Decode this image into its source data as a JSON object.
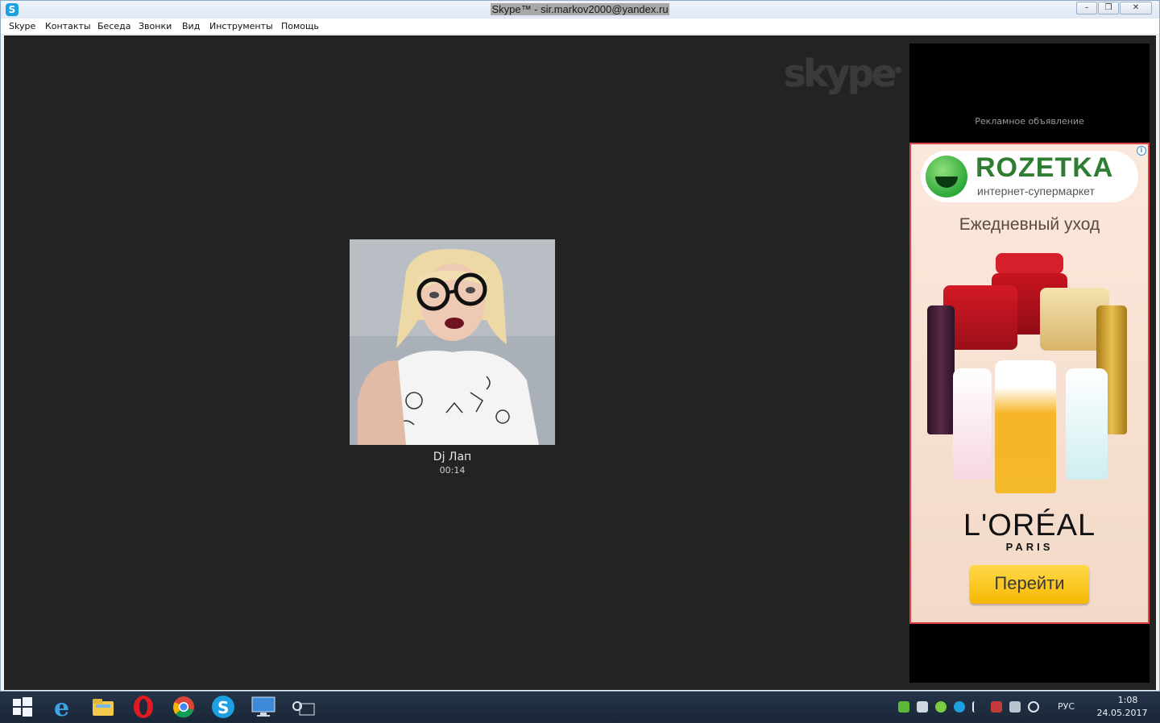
{
  "window": {
    "title": "Skype™ - sir.markov2000@yandex.ru",
    "app_icon": "skype-icon",
    "controls": [
      "minimize-icon",
      "restore-icon",
      "close-icon"
    ]
  },
  "menu": [
    "Skype",
    "Контакты",
    "Беседа",
    "Звонки",
    "Вид",
    "Инструменты",
    "Помощь"
  ],
  "call": {
    "watermark": "skype",
    "caller_name": "Dj Лап",
    "duration": "00:14"
  },
  "ad": {
    "label": "Рекламное объявление",
    "brand": "ROZETKA",
    "tagline": "интернет-супермаркет",
    "headline": "Ежедневный уход",
    "product_brand": "L'ORÉAL",
    "product_brand_sub": "PARIS",
    "cta": "Перейти",
    "accent_color": "#e0424a",
    "cta_color": "#f6b800"
  },
  "taskbar": {
    "apps": [
      "windows-start-icon",
      "internet-explorer-icon",
      "file-explorer-icon",
      "opera-icon",
      "chrome-icon",
      "skype-icon",
      "remote-desktop-icon",
      "camera-app-icon"
    ],
    "language": "РУС",
    "time": "1:08",
    "date": "24.05.2017"
  }
}
